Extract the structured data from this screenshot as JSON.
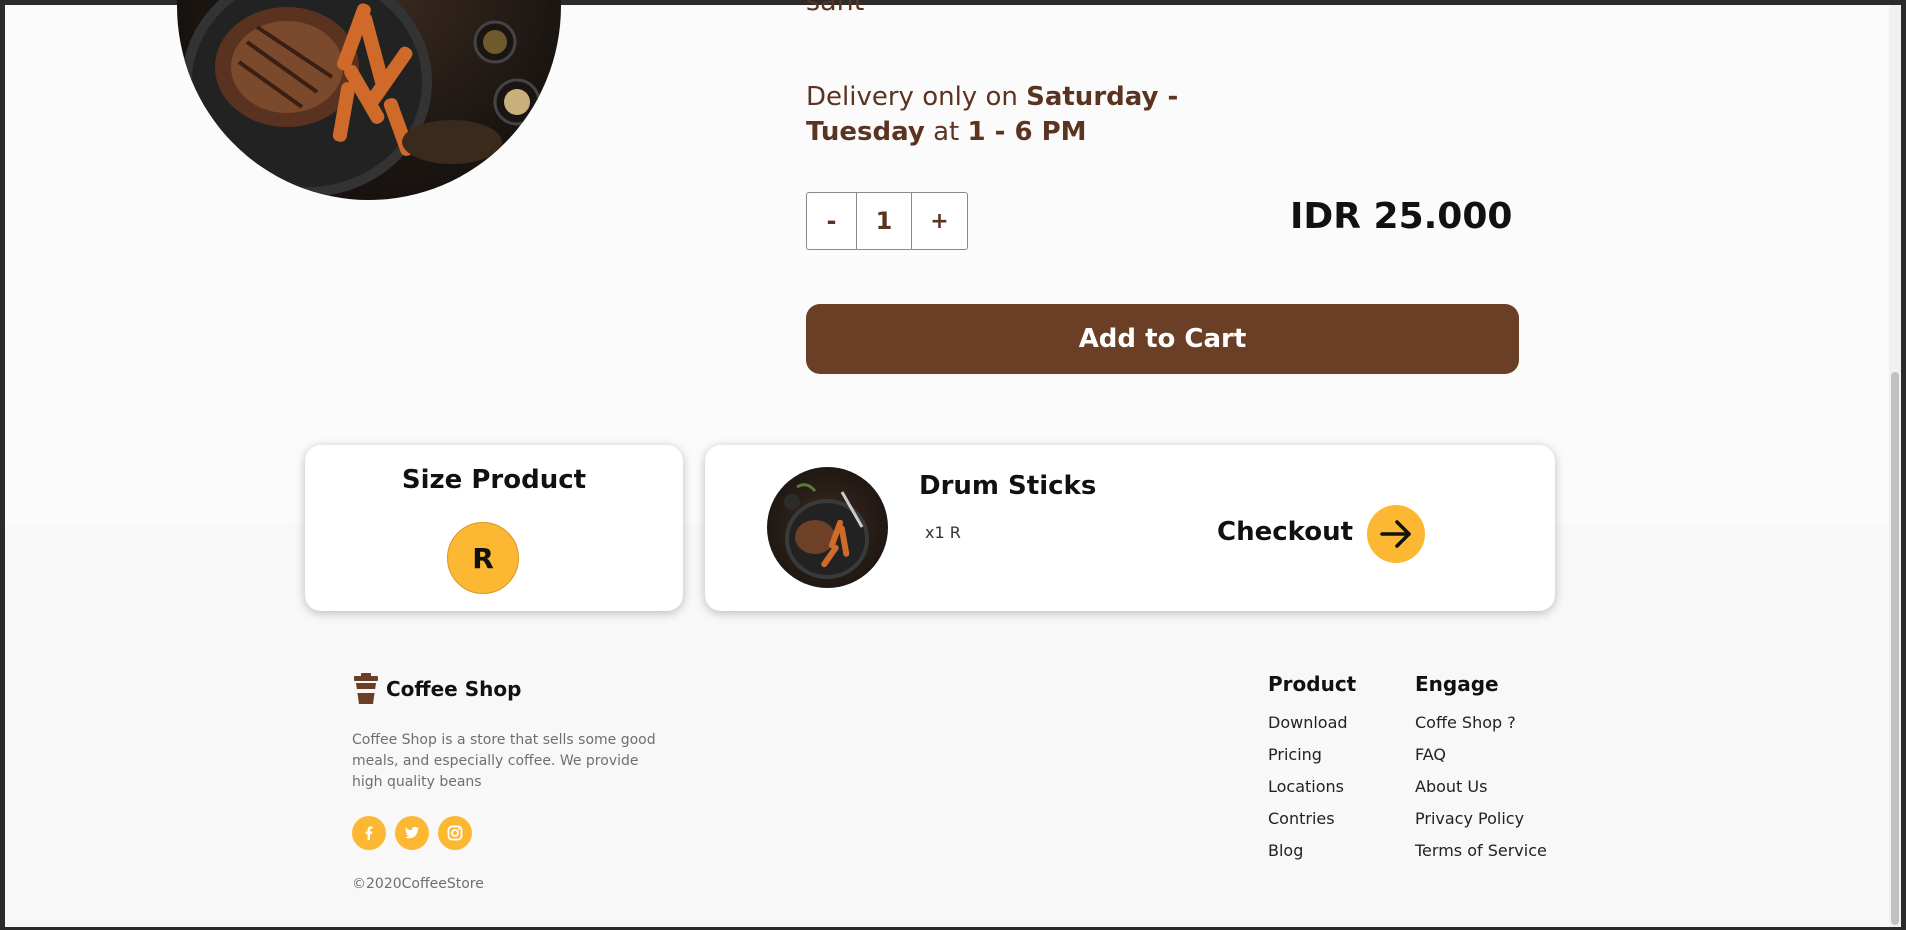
{
  "product": {
    "cut_text": "sant",
    "delivery": {
      "prefix": "Delivery only on ",
      "days": "Saturday - Tuesday",
      "mid": " at ",
      "hours": "1 - 6 PM"
    },
    "quantity": {
      "minus_label": "-",
      "value": "1",
      "plus_label": "+"
    },
    "price": "IDR 25.000",
    "add_to_cart_label": "Add to Cart"
  },
  "size_card": {
    "title": "Size Product",
    "selected_size": "R"
  },
  "checkout_card": {
    "item_name": "Drum Sticks",
    "item_qty": "x1 R",
    "checkout_label": "Checkout"
  },
  "footer": {
    "brand_name": "Coffee Shop",
    "description": "Coffee Shop is a store that sells some good meals, and especially coffee. We provide high quality beans",
    "socials": [
      "facebook-icon",
      "twitter-icon",
      "instagram-icon"
    ],
    "copyright": "©2020CoffeeStore",
    "product_col": {
      "title": "Product",
      "links": [
        "Download",
        "Pricing",
        "Locations",
        "Contries",
        "Blog"
      ]
    },
    "engage_col": {
      "title": "Engage",
      "links": [
        "Coffe Shop ?",
        "FAQ",
        "About Us",
        "Privacy Policy",
        "Terms of Service"
      ]
    }
  },
  "colors": {
    "brand_brown": "#6b3e26",
    "text_brown": "#5b3321",
    "accent_yellow": "#fdb833"
  }
}
